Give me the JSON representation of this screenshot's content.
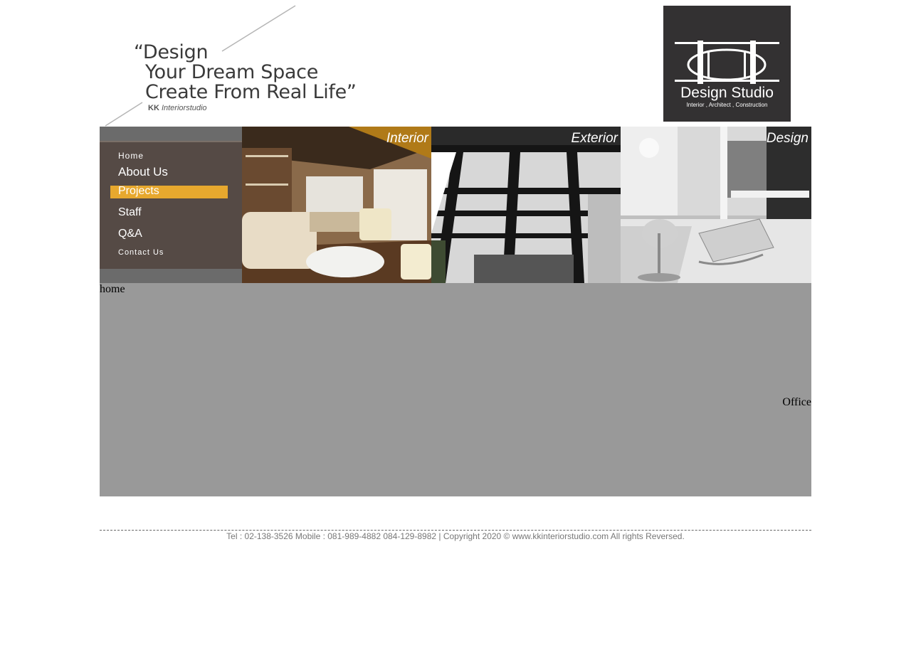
{
  "header": {
    "slogan": {
      "line1": "“Design",
      "line2": "Your Dream Space",
      "line3": "Create From Real Life”",
      "brand_bold": "KK",
      "brand_rest": "Interiorstudio"
    },
    "logo": {
      "name": "Design Studio",
      "tagline": "Interior , Architect , Construction",
      "background": "#333132"
    }
  },
  "nav": {
    "items": [
      {
        "label": "Home"
      },
      {
        "label": "About Us"
      },
      {
        "label": "Projects",
        "active": true
      },
      {
        "label": "Staff"
      },
      {
        "label": "Q&A"
      },
      {
        "label": "Contact Us"
      }
    ],
    "active_color": "#e7a82e",
    "panel_color": "#554a45"
  },
  "banner": {
    "photos": [
      {
        "caption": "Interior",
        "icon": "interior-photo"
      },
      {
        "caption": "Exterior",
        "icon": "exterior-photo"
      },
      {
        "caption": "Design",
        "icon": "design-photo"
      }
    ]
  },
  "content": {
    "home_text": "home",
    "office_text": "Office",
    "background": "#999999"
  },
  "footer": {
    "text": "Tel : 02-138-3526 Mobile : 081-989-4882 084-129-8982  |  Copyright 2020 © www.kkinteriorstudio.com All rights Reversed."
  }
}
